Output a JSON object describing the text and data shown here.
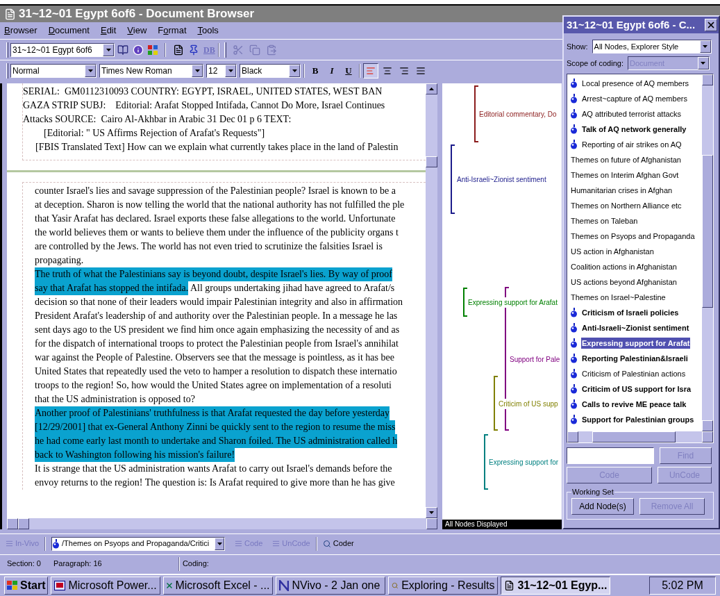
{
  "window": {
    "title": "31~12~01 Egypt 6of6 - Document Browser"
  },
  "menu": [
    {
      "label": "Browser"
    },
    {
      "label": "Document"
    },
    {
      "label": "Edit"
    },
    {
      "label": "View"
    },
    {
      "label": "Format"
    },
    {
      "label": "Tools"
    }
  ],
  "toolbar": {
    "document": "31~12~01 Egypt 6of6",
    "db_label": "DB",
    "edit_buttons": [
      {
        "disabled": true
      },
      {
        "disabled": true
      },
      {
        "disabled": true
      }
    ]
  },
  "format_bar": {
    "style": "Normal",
    "font": "Times New Roman",
    "size": "12",
    "color_name": "Black",
    "text_buttons": [
      "B",
      "I",
      "U"
    ],
    "alignments": [
      {
        "selected": true
      },
      {
        "selected": false
      },
      {
        "selected": false
      },
      {
        "selected": false
      }
    ]
  },
  "document": {
    "header_lines": [
      {
        "text": "SERIAL:  GM0112310093 COUNTRY: EGYPT, ISRAEL, UNITED STATES, WEST BAN",
        "kind": "header"
      },
      {
        "text": "GAZA STRIP SUBJ:    Editorial: Arafat Stopped Intifada, Cannot Do More, Israel Continues",
        "kind": "header"
      },
      {
        "text": "Attacks SOURCE:  Cairo Al-Akhbar in Arabic 31 Dec 01 p 6 TEXT:",
        "kind": "header"
      },
      {
        "text": "[Editorial: \" US Affirms Rejection of Arafat's Requests\"]",
        "kind": "title"
      },
      {
        "text": "[FBIS Translated Text] How can we explain what currently takes place in the land of Palestin",
        "kind": "paragraph"
      }
    ],
    "body_lines": [
      [
        {
          "text": "counter Israel's lies and savage suppression of the Palestinian people? Israel is known to be a",
          "highlighted": false
        }
      ],
      [
        {
          "text": "at deception. Sharon is now telling the world that the national authority has not fulfilled the ple",
          "highlighted": false
        }
      ],
      [
        {
          "text": "that Yasir Arafat has declared. Israel exports these false allegations to the world. Unfortunate",
          "highlighted": false
        }
      ],
      [
        {
          "text": "the world believes them or wants to believe them under the influence of the publicity organs t",
          "highlighted": false
        }
      ],
      [
        {
          "text": "are controlled by the Jews. The world has not even tried to scrutinize the falsities Israel is",
          "highlighted": false
        }
      ],
      [
        {
          "text": "propagating.",
          "highlighted": false
        }
      ],
      [
        {
          "text": "The truth of what the Palestinians say is beyond doubt, despite Israel's lies. By way of proof",
          "highlighted": true
        }
      ],
      [
        {
          "text": "say that Arafat has stopped the intifada.",
          "highlighted": true
        },
        {
          "text": " All groups undertaking jihad have agreed to Arafat/s",
          "highlighted": false
        }
      ],
      [
        {
          "text": "decision so that none of their leaders would impair Palestinian integrity and also in affirmation",
          "highlighted": false
        }
      ],
      [
        {
          "text": "President Arafat's leadership of and authority over the Palestinian people. In a message he las",
          "highlighted": false
        }
      ],
      [
        {
          "text": "sent days ago to the US president we find him once again emphasizing the necessity of and as",
          "highlighted": false
        }
      ],
      [
        {
          "text": "for the dispatch of international troops to protect the Palestinian people from Israel's annihilat",
          "highlighted": false
        }
      ],
      [
        {
          "text": "war against the People of Palestine. Observers see that the message is pointless, as it has bee",
          "highlighted": false
        }
      ],
      [
        {
          "text": "United States that repeatedly used the veto to hamper a resolution to dispatch these internatio",
          "highlighted": false
        }
      ],
      [
        {
          "text": "troops to the region! So, how would the United States agree on implementation of a resoluti",
          "highlighted": false
        }
      ],
      [
        {
          "text": "that the US administration is opposed to?",
          "highlighted": false
        }
      ],
      [
        {
          "text": "Another proof of Palestinians' truthfulness is that Arafat requested the day before yesterday",
          "highlighted": true
        }
      ],
      [
        {
          "text": "[12/29/2001] that ex-General Anthony Zinni be quickly sent to the region to resume the miss",
          "highlighted": true
        }
      ],
      [
        {
          "text": "he had come early last month to undertake and Sharon foiled. The US administration called h",
          "highlighted": true
        }
      ],
      [
        {
          "text": "back to Washington following his mission's failure!",
          "highlighted": true
        }
      ],
      [
        {
          "text": "It is strange that the US administration wants Arafat to carry out Israel's demands before the",
          "highlighted": false
        }
      ],
      [
        {
          "text": "envoy returns to the region! The question is: Is Arafat required to give more than he has give",
          "highlighted": false
        }
      ]
    ]
  },
  "coding_stripes": {
    "stripes": [
      {
        "label": "Editorial commentary, Do",
        "color": "#8b1c1c"
      },
      {
        "label": "Anti-Israeli~Zionist sentiment",
        "color": "#1c1c8b"
      },
      {
        "label": "Expressing support for Arafat",
        "color": "#008000"
      },
      {
        "label": "Support for Pale",
        "color": "#800080"
      },
      {
        "label": "Criticim of US supp",
        "color": "#808000"
      },
      {
        "label": "Expressing support for",
        "color": "#008080"
      }
    ],
    "status": "All Nodes Displayed"
  },
  "coding_toolbar": {
    "invivo": {
      "label": "In-Vivo",
      "disabled": true
    },
    "node_path": "/Themes on Psyops and Propaganda/Critici",
    "code": {
      "label": "Code",
      "disabled": true
    },
    "uncode": {
      "label": "UnCode",
      "disabled": true
    },
    "coder": {
      "label": "Coder",
      "disabled": false
    }
  },
  "status_bar": {
    "section": "Section: 0",
    "paragraph": "Paragraph: 16",
    "coding": "Coding:"
  },
  "coder_panel": {
    "title": "31~12~01 Egypt 6of6 - C...",
    "show_label": "Show:",
    "show_value": "All Nodes, Explorer Style",
    "scope_label": "Scope of coding:",
    "scope_value": "Document",
    "scope_disabled": true,
    "nodes": [
      {
        "label": "Local presence of AQ members",
        "kind": "node",
        "bold": false,
        "selected": false
      },
      {
        "label": "Arrest~capture of AQ members",
        "kind": "node",
        "bold": false,
        "selected": false
      },
      {
        "label": "AQ attributed terrorist attacks",
        "kind": "node",
        "bold": false,
        "selected": false
      },
      {
        "label": "Talk of AQ network generally",
        "kind": "node",
        "bold": true,
        "selected": false
      },
      {
        "label": "Reporting of air strikes on AQ",
        "kind": "node",
        "bold": false,
        "selected": false
      },
      {
        "label": "Themes on future of Afghanistan",
        "kind": "category",
        "bold": false,
        "selected": false
      },
      {
        "label": "Themes on Interim Afghan Govt",
        "kind": "category",
        "bold": false,
        "selected": false
      },
      {
        "label": "Humanitarian crises in Afghan",
        "kind": "category",
        "bold": false,
        "selected": false
      },
      {
        "label": "Themes on Northern Alliance etc",
        "kind": "category",
        "bold": false,
        "selected": false
      },
      {
        "label": "Themes on Taleban",
        "kind": "category",
        "bold": false,
        "selected": false
      },
      {
        "label": "Themes on Psyops and Propaganda",
        "kind": "category",
        "bold": false,
        "selected": false
      },
      {
        "label": "US action in Afghanistan",
        "kind": "category",
        "bold": false,
        "selected": false
      },
      {
        "label": "Coalition actions in Afghanistan",
        "kind": "category",
        "bold": false,
        "selected": false
      },
      {
        "label": "US actions beyond Afghanistan",
        "kind": "category",
        "bold": false,
        "selected": false
      },
      {
        "label": "Themes on Israel~Palestine",
        "kind": "category",
        "bold": false,
        "selected": false
      },
      {
        "label": "Criticism of Israeli policies",
        "kind": "node",
        "bold": true,
        "selected": false
      },
      {
        "label": "Anti-Israeli~Zionist sentiment",
        "kind": "node",
        "bold": true,
        "selected": false
      },
      {
        "label": "Expressing support for Arafat",
        "kind": "node",
        "bold": true,
        "selected": true
      },
      {
        "label": "Reporting Palestinian&Israeli",
        "kind": "node",
        "bold": true,
        "selected": false
      },
      {
        "label": "Criticism of Palestinian actions",
        "kind": "node",
        "bold": false,
        "selected": false
      },
      {
        "label": "Criticim of US support for Isra",
        "kind": "node",
        "bold": true,
        "selected": false
      },
      {
        "label": "Calls to revive ME peace talk",
        "kind": "node",
        "bold": true,
        "selected": false
      },
      {
        "label": "Support for Palestinian groups",
        "kind": "node",
        "bold": true,
        "selected": false
      }
    ],
    "find": {
      "label": "Find",
      "disabled": true
    },
    "code": {
      "label": "Code",
      "disabled": true
    },
    "uncode": {
      "label": "UnCode",
      "disabled": true
    },
    "working_set": {
      "legend": "Working Set",
      "add": {
        "label": "Add Node(s)",
        "disabled": false
      },
      "remove": {
        "label": "Remove All",
        "disabled": true
      }
    }
  },
  "taskbar": {
    "start": "Start",
    "tasks": [
      {
        "label": "Microsoft Power...",
        "kind": "slides",
        "selected": false
      },
      {
        "label": "Microsoft Excel - ...",
        "kind": "excel",
        "selected": false
      },
      {
        "label": "NVivo - 2 Jan one",
        "kind": "nvivo",
        "selected": false
      },
      {
        "label": "Exploring - Results",
        "kind": "explorer",
        "selected": false
      },
      {
        "label": "31~12~01 Egyp...",
        "kind": "document",
        "selected": true
      }
    ],
    "clock": "5:02 PM"
  }
}
